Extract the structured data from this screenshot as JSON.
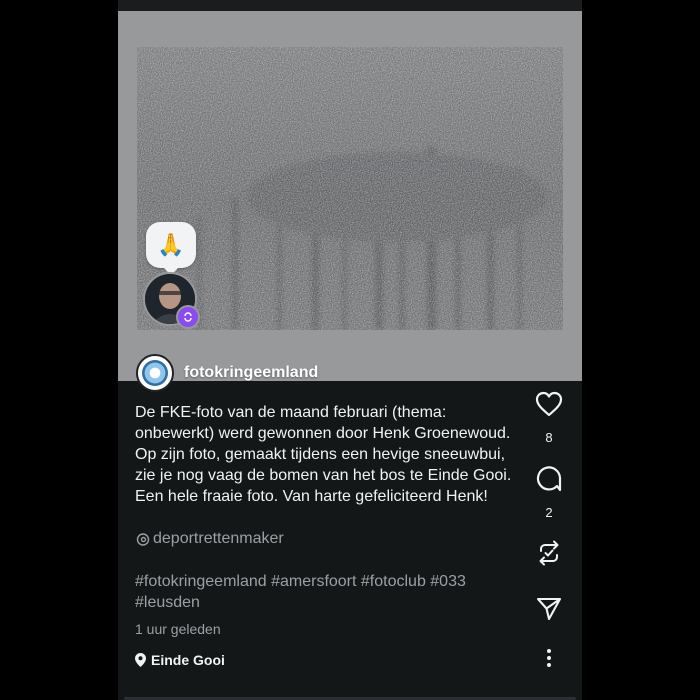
{
  "post": {
    "username": "fotokringeemland",
    "caption": "De FKE-foto van de maand februari (thema: onbewerkt) werd gewonnen door Henk Groenewoud. Op zijn foto, gemaakt tijdens een hevige sneeuwbui, zie je nog vaag de bomen van het bos te Einde Gooi. Een hele fraaie foto. Van harte gefeliciteerd Henk!",
    "mention": "deportrettenmaker",
    "hashtags": "#fotokringeemland #amersfoort #fotoclub #033 #leusden",
    "timestamp": "1 uur geleden",
    "location": "Einde Gooi"
  },
  "reaction": {
    "emoji": "🙏",
    "emoji_name": "folded-hands",
    "badge_icon": "repost-icon"
  },
  "actions": {
    "like_count": "8",
    "reply_count": "2",
    "icons": [
      "heart-icon",
      "comment-icon",
      "repost-icon",
      "share-icon",
      "more-icon"
    ]
  },
  "colors": {
    "background": "#141718",
    "text": "#f1f2f3",
    "muted": "#9aa0a6",
    "badge": "#8a4cf0"
  }
}
